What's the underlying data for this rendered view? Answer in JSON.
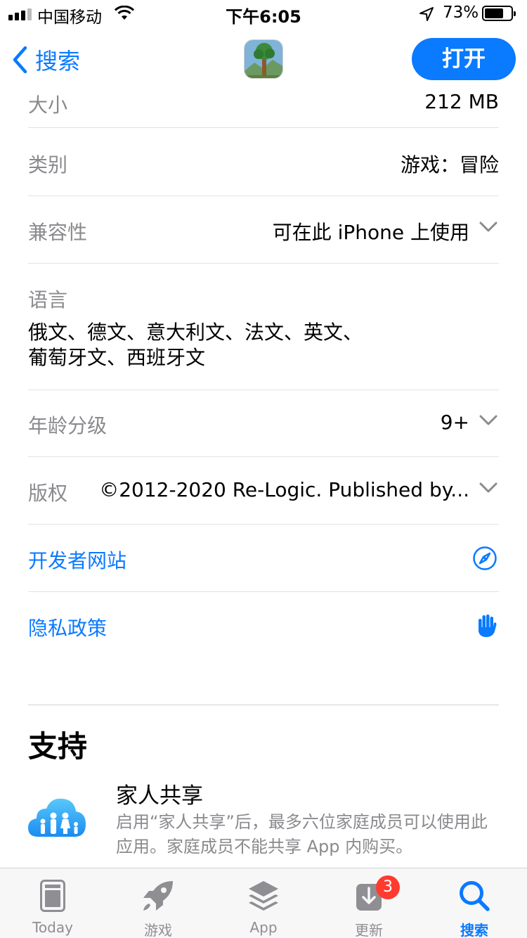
{
  "status_bar": {
    "carrier": "中国移动",
    "time": "下午6:05",
    "battery_percent": "73%",
    "battery_level": 0.73,
    "signal_bars": 4,
    "signal_filled": 3
  },
  "nav": {
    "back_label": "搜索",
    "open_label": "打开",
    "app_icon": "terraria-app-icon"
  },
  "info": {
    "size": {
      "label": "大小",
      "value": "212 MB"
    },
    "category": {
      "label": "类别",
      "value": "游戏：冒险"
    },
    "compatibility": {
      "label": "兼容性",
      "value": "可在此 iPhone 上使用"
    },
    "languages": {
      "label": "语言",
      "line1": "俄文、德文、意大利文、法文、英文、",
      "line2": "葡萄牙文、西班牙文"
    },
    "age_rating": {
      "label": "年龄分级",
      "value": "9+"
    },
    "copyright": {
      "label": "版权",
      "value": "©2012-2020 Re-Logic. Published by..."
    },
    "developer_site": {
      "label": "开发者网站",
      "icon": "compass-icon"
    },
    "privacy_policy": {
      "label": "隐私政策",
      "icon": "hand-icon"
    }
  },
  "support": {
    "title": "支持",
    "family_sharing": {
      "title": "家人共享",
      "description": "启用“家人共享”后，最多六位家庭成员可以使用此应用。家庭成员不能共享 App 内购买。"
    }
  },
  "tab_bar": {
    "tabs": [
      {
        "label": "Today",
        "icon": "today-icon"
      },
      {
        "label": "游戏",
        "icon": "rocket-icon"
      },
      {
        "label": "App",
        "icon": "layers-icon"
      },
      {
        "label": "更新",
        "icon": "download-icon",
        "badge": "3"
      },
      {
        "label": "搜索",
        "icon": "search-icon",
        "active": true
      }
    ]
  },
  "colors": {
    "accent": "#0a7aff",
    "label_gray": "#8a8a8e",
    "badge_red": "#ff3b30"
  }
}
